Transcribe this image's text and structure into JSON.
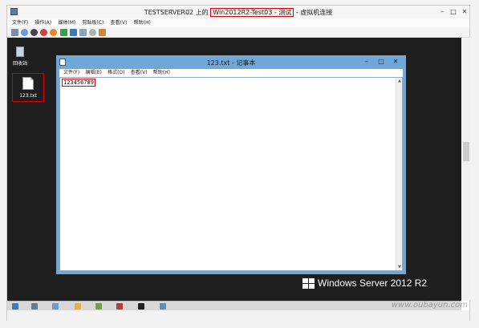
{
  "vm_window": {
    "title_prefix": "TESTSERVER02 上的",
    "title_highlight": "Win2012R2-Test03 - 测试",
    "title_suffix": "- 虚拟机连接",
    "menu": [
      "文件(F)",
      "操作(A)",
      "媒体(M)",
      "剪贴板(C)",
      "查看(V)",
      "帮助(H)"
    ]
  },
  "desktop": {
    "recycle_label": "回收站",
    "file_label": "123.txt"
  },
  "notepad": {
    "title": "123.txt - 记事本",
    "menu": [
      "文件(F)",
      "编辑(E)",
      "格式(O)",
      "查看(V)",
      "帮助(H)"
    ],
    "content": "123456789"
  },
  "branding": "Windows Server 2012 R2",
  "watermark": "www.oubayun.com",
  "colors": {
    "highlight_border": "#dd0000",
    "notepad_frame": "#6fa8d8",
    "desktop_bg": "#1e1e1e"
  }
}
